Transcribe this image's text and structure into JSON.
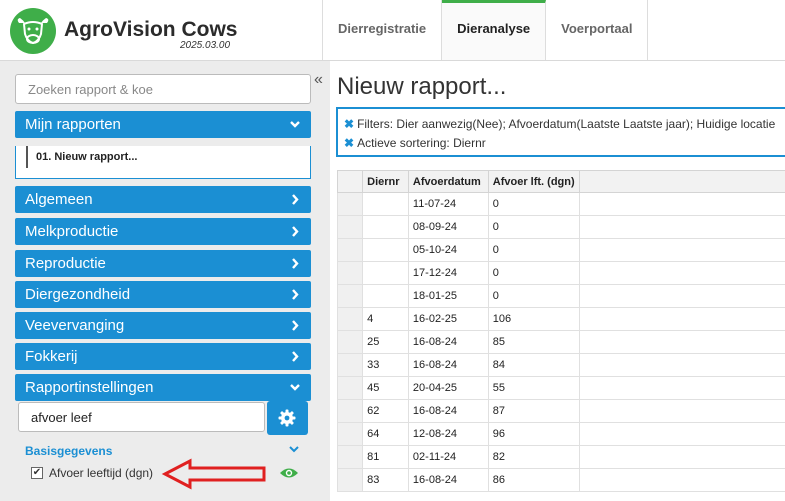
{
  "app": {
    "title": "AgroVision Cows",
    "version": "2025.03.00"
  },
  "nav": {
    "tabs": [
      {
        "label": "Dierregistratie"
      },
      {
        "label": "Dieranalyse"
      },
      {
        "label": "Voerportaal"
      }
    ],
    "active": "Dieranalyse"
  },
  "sidebar": {
    "search_placeholder": "Zoeken rapport & koe",
    "collapse_glyph": "«",
    "my_reports": {
      "label": "Mijn rapporten",
      "items": [
        {
          "label": "01. Nieuw rapport..."
        }
      ]
    },
    "categories": [
      {
        "label": "Algemeen"
      },
      {
        "label": "Melkproductie"
      },
      {
        "label": "Reproductie"
      },
      {
        "label": "Diergezondheid"
      },
      {
        "label": "Veevervanging"
      },
      {
        "label": "Fokkerij"
      }
    ],
    "settings": {
      "label": "Rapportinstellingen",
      "search_value": "afvoer leef",
      "section": "Basisgegevens",
      "fields": [
        {
          "label": "Afvoer leeftijd (dgn)",
          "checked": true
        }
      ]
    }
  },
  "main": {
    "title": "Nieuw rapport...",
    "filters": "Filters: Dier aanwezig(Nee);  Afvoerdatum(Laatste Laatste jaar);  Huidige locatie",
    "sorting": "Actieve sortering: Diernr",
    "table": {
      "headers": [
        "Diernr",
        "Afvoerdatum",
        "Afvoer lft. (dgn)"
      ],
      "rows": [
        [
          "",
          "11-07-24",
          "0"
        ],
        [
          "",
          "08-09-24",
          "0"
        ],
        [
          "",
          "05-10-24",
          "0"
        ],
        [
          "",
          "17-12-24",
          "0"
        ],
        [
          "",
          "18-01-25",
          "0"
        ],
        [
          "4",
          "16-02-25",
          "106"
        ],
        [
          "25",
          "16-08-24",
          "85"
        ],
        [
          "33",
          "16-08-24",
          "84"
        ],
        [
          "45",
          "20-04-25",
          "55"
        ],
        [
          "62",
          "16-08-24",
          "87"
        ],
        [
          "64",
          "12-08-24",
          "96"
        ],
        [
          "81",
          "02-11-24",
          "82"
        ],
        [
          "83",
          "16-08-24",
          "86"
        ]
      ]
    }
  },
  "colors": {
    "accent": "#1b8fd3",
    "brand": "#3fae49",
    "arrow": "#e02020"
  }
}
